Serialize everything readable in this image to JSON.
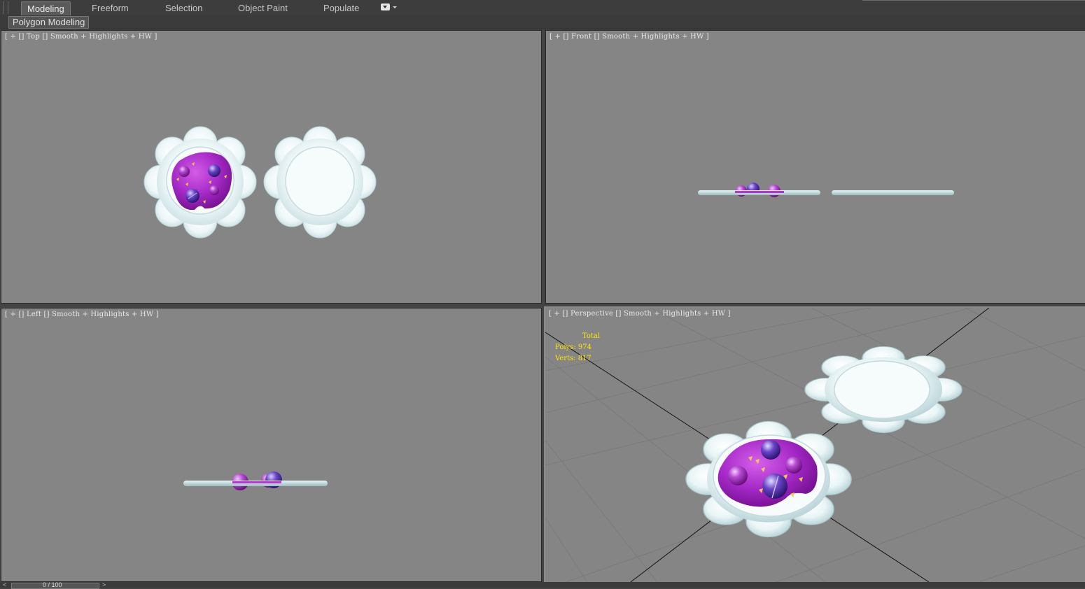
{
  "ribbon": {
    "tabs": [
      {
        "label": "Modeling",
        "active": true
      },
      {
        "label": "Freeform",
        "active": false
      },
      {
        "label": "Selection",
        "active": false
      },
      {
        "label": "Object Paint",
        "active": false
      },
      {
        "label": "Populate",
        "active": false
      }
    ],
    "panel_label": "Polygon Modeling"
  },
  "viewports": {
    "top": {
      "label": "[ + [] Top [] Smooth + Highlights + HW ]"
    },
    "front": {
      "label": "[ + [] Front [] Smooth + Highlights + HW ]"
    },
    "left": {
      "label": "[ + [] Left [] Smooth + Highlights + HW ]"
    },
    "perspective": {
      "label": "[ + [] Perspective [] Smooth + Highlights + HW ]",
      "stats": {
        "title": "Total",
        "polys": "Polys: 974",
        "verts": "Verts: 817"
      }
    }
  },
  "time_slider": {
    "value": "0 / 100"
  },
  "colors": {
    "viewport_bg": "#858585",
    "stats_text": "#ffe600",
    "plate": "#e4f2f3",
    "jam": "#a227c4"
  }
}
